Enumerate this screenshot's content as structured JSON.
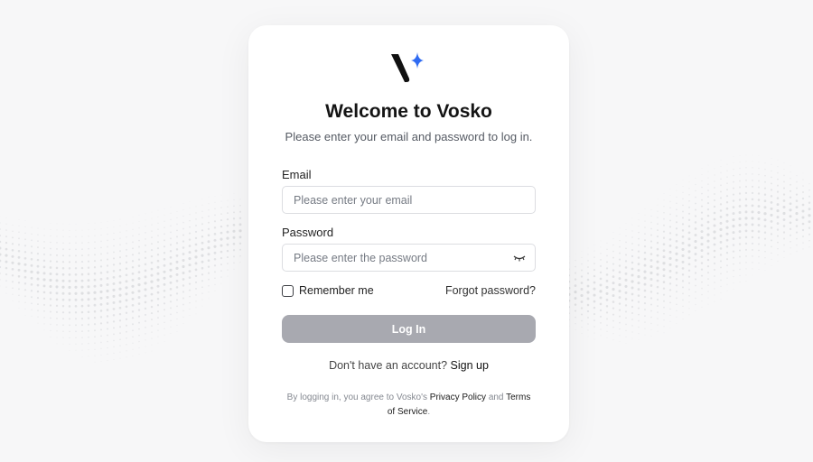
{
  "brand": {
    "name": "Vosko",
    "accent_color": "#2f6bf2",
    "logo_icon": "vosko-v-sparkle-logo"
  },
  "header": {
    "title": "Welcome to Vosko",
    "subtitle": "Please enter your email and password to log in."
  },
  "form": {
    "email_label": "Email",
    "email_placeholder": "Please enter your email",
    "email_value": "",
    "password_label": "Password",
    "password_placeholder": "Please enter the password",
    "password_value": "",
    "password_toggle_icon": "eye-closed-icon",
    "remember_label": "Remember me",
    "remember_checked": false,
    "forgot_label": "Forgot password?",
    "submit_label": "Log In",
    "submit_color": "#a8a9b0"
  },
  "signup": {
    "prompt": "Don't have an account?",
    "link": "Sign up"
  },
  "legal": {
    "prefix": "By logging in, you agree to Vosko's",
    "privacy": "Privacy Policy",
    "conjunction": "and",
    "terms": "Terms of Service",
    "suffix": "."
  }
}
